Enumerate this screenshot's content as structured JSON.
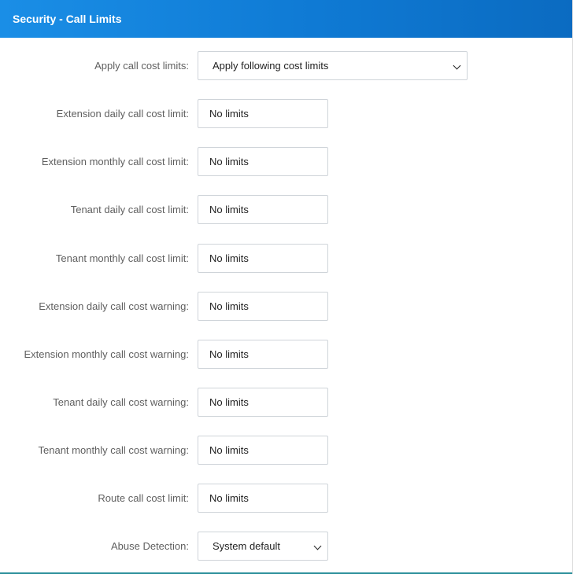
{
  "panel": {
    "title": "Security - Call Limits"
  },
  "fields": {
    "apply_call_cost_limits": {
      "label": "Apply call cost limits:",
      "value": "Apply following cost limits"
    },
    "extension_daily_limit": {
      "label": "Extension daily call cost limit:",
      "value": "No limits"
    },
    "extension_monthly_limit": {
      "label": "Extension monthly call cost limit:",
      "value": "No limits"
    },
    "tenant_daily_limit": {
      "label": "Tenant daily call cost limit:",
      "value": "No limits"
    },
    "tenant_monthly_limit": {
      "label": "Tenant monthly call cost limit:",
      "value": "No limits"
    },
    "extension_daily_warning": {
      "label": "Extension daily call cost warning:",
      "value": "No limits"
    },
    "extension_monthly_warning": {
      "label": "Extension monthly call cost warning:",
      "value": "No limits"
    },
    "tenant_daily_warning": {
      "label": "Tenant daily call cost warning:",
      "value": "No limits"
    },
    "tenant_monthly_warning": {
      "label": "Tenant monthly call cost warning:",
      "value": "No limits"
    },
    "route_limit": {
      "label": "Route call cost limit:",
      "value": "No limits"
    },
    "abuse_detection": {
      "label": "Abuse Detection:",
      "value": "System default"
    }
  }
}
